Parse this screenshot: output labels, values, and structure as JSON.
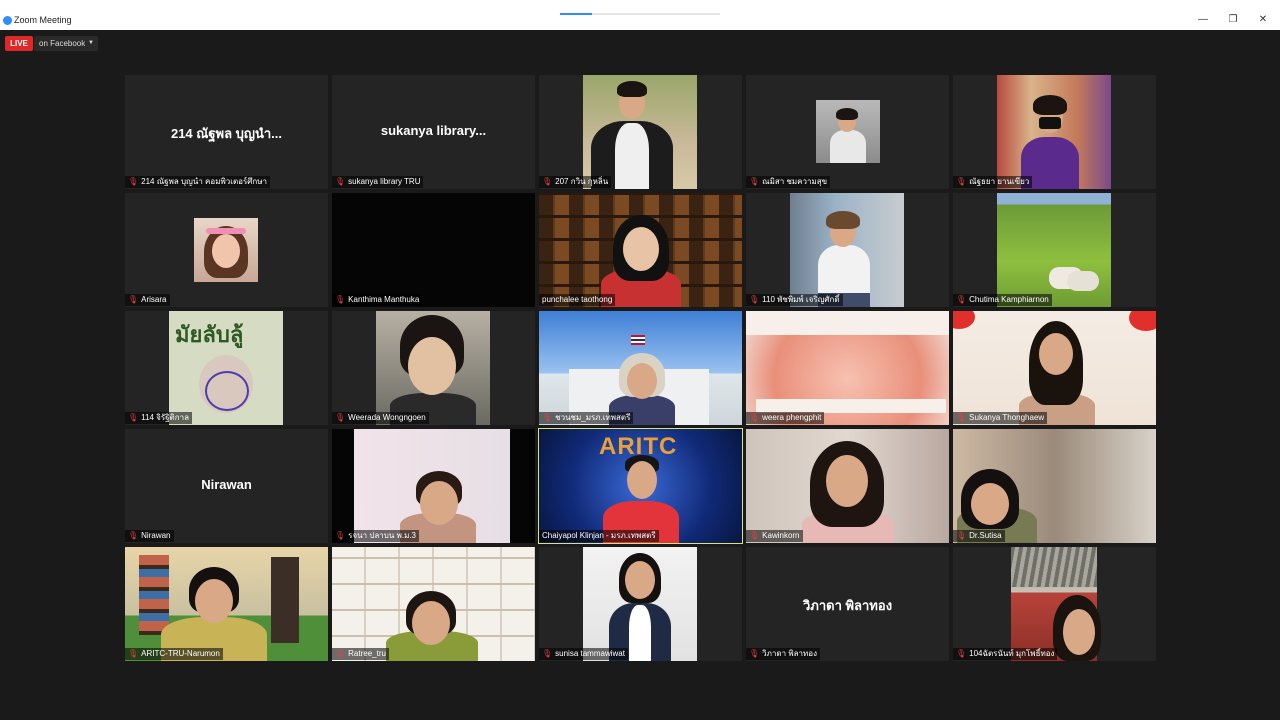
{
  "window": {
    "title": "Zoom Meeting",
    "progress": 0.2
  },
  "window_controls": {
    "minimize": "—",
    "restore": "❐",
    "close": "✕"
  },
  "live": {
    "badge": "LIVE",
    "target": "on Facebook",
    "caret": "▼"
  },
  "mic_icon": "🎙",
  "participants": [
    {
      "center_name": "214 ณัฐพล บุญนำ...",
      "label": "214 ณัฐพล บุญนำ คอมพิวเตอร์ศึกษา"
    },
    {
      "center_name": "sukanya library...",
      "label": "sukanya library TRU"
    },
    {
      "label": "207 กวิน กุหลิ่น"
    },
    {
      "label": "ณมิสา ชมความสุข"
    },
    {
      "label": "ณัฐธยา ยานเขียว"
    },
    {
      "label": "Arisara"
    },
    {
      "label": "Kanthima Manthuka"
    },
    {
      "label": "punchalee taothong"
    },
    {
      "label": "110 พัชพิมพ์ เจริญศักดิ์"
    },
    {
      "label": "Chutima Kamphiarnon"
    },
    {
      "label": "114 จิรัฐิติกาล",
      "sign_text": "มัยลับลู้"
    },
    {
      "label": "Weerada Wongngoen"
    },
    {
      "label": "ชวนชม_มรภ.เทพสตรี"
    },
    {
      "label": "weera phengphit"
    },
    {
      "label": "Sukanya Thonghaew"
    },
    {
      "center_name": "Nirawan",
      "label": "Nirawan"
    },
    {
      "label": "รจนา ปลาบน พ.ม.3"
    },
    {
      "label": "Chaiyapol Klinjan - มรภ.เทพสตรี",
      "banner": "ARITC"
    },
    {
      "label": "Kawinkorn"
    },
    {
      "label": "Dr.Sutisa"
    },
    {
      "label": "ARITC-TRU-Narumon"
    },
    {
      "label": "Ratree_tru"
    },
    {
      "label": "sunisa tammawiwat"
    },
    {
      "center_name": "วิภาดา พิลาทอง",
      "label": "วิภาดา พิลาทอง"
    },
    {
      "label": "104ฉัตรนันท์ มุกโพธิ์ทอง"
    }
  ],
  "colors": {
    "accent": "#2d8cff",
    "live": "#e02828",
    "active_speaker": "#dbe37a",
    "muted_mic": "#e34040"
  }
}
